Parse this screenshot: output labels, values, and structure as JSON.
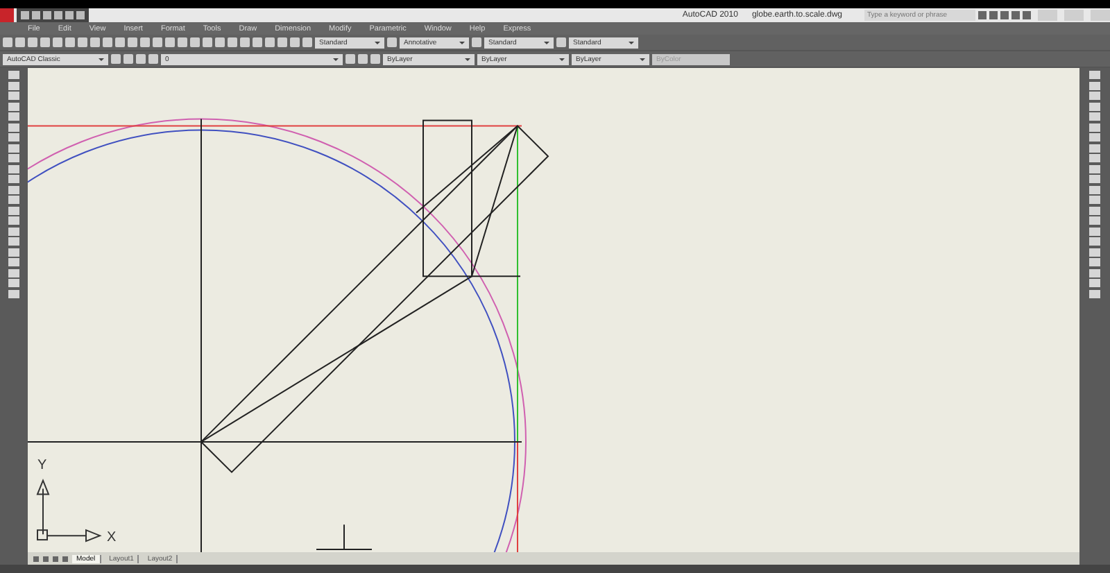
{
  "window": {
    "app_title": "AutoCAD 2010",
    "file_name": "globe.earth.to.scale.dwg"
  },
  "search": {
    "placeholder": "Type a keyword or phrase"
  },
  "menu": [
    "File",
    "Edit",
    "View",
    "Insert",
    "Format",
    "Tools",
    "Draw",
    "Dimension",
    "Modify",
    "Parametric",
    "Window",
    "Help",
    "Express"
  ],
  "standard_toolbar": {
    "dropdowns": [
      "Standard",
      "Annotative",
      "Standard",
      "Standard"
    ]
  },
  "properties_toolbar": {
    "workspace": "AutoCAD Classic",
    "layer": "0",
    "color_control": "ByLayer",
    "linetype": "ByLayer",
    "lineweight": "ByLayer",
    "plot_style": "ByColor"
  },
  "ucs_icon": {
    "y_label": "Y",
    "x_label": "X"
  },
  "layout_tabs": [
    {
      "label": "Model",
      "selected": true
    },
    {
      "label": "Layout1",
      "selected": false
    },
    {
      "label": "Layout2",
      "selected": false
    }
  ]
}
